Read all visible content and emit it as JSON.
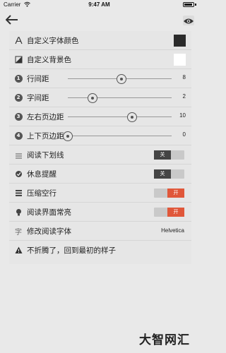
{
  "status_bar": {
    "carrier": "Carrier",
    "time": "9:47 AM"
  },
  "settings": {
    "font_color": {
      "label": "自定义字体颜色",
      "swatch": "#2b2b2b"
    },
    "bg_color": {
      "label": "自定义背景色",
      "swatch": "#ffffff"
    },
    "sliders": [
      {
        "num": "1",
        "label": "行间距",
        "value": "8",
        "fraction": 0.52
      },
      {
        "num": "2",
        "label": "字间距",
        "value": "2",
        "fraction": 0.24
      },
      {
        "num": "3",
        "label": "左右页边距",
        "value": "10",
        "fraction": 0.62
      },
      {
        "num": "4",
        "label": "上下页边距",
        "value": "0",
        "fraction": 0.0
      }
    ],
    "toggles": [
      {
        "label": "阅读下划线",
        "text": "关",
        "state": "off"
      },
      {
        "label": "休息提醒",
        "text": "关",
        "state": "off"
      },
      {
        "label": "压缩空行",
        "text": "开",
        "state": "on"
      },
      {
        "label": "阅读界面常亮",
        "text": "开",
        "state": "on"
      }
    ],
    "font": {
      "label": "修改阅读字体",
      "value": "Helvetica"
    },
    "reset": {
      "label": "不折腾了，回到最初的样子"
    }
  },
  "watermark": "大智网汇",
  "colors": {
    "accent": "#e0573a",
    "toggle_off": "#444444"
  }
}
